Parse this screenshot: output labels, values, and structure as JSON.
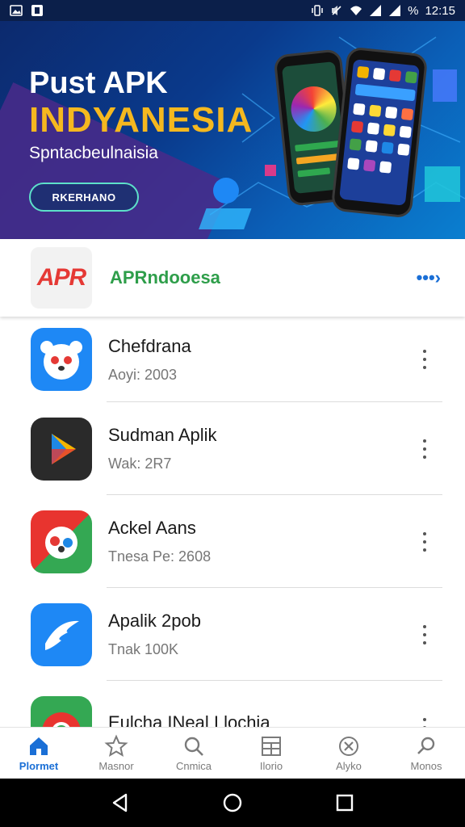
{
  "status_bar": {
    "time": "12:15",
    "battery": "%"
  },
  "banner": {
    "title_line1": "Pust APK",
    "title_line2": "INDYANESIA",
    "subtitle": "Spntacbeulnaisia",
    "cta_label": "RKERHANO"
  },
  "header": {
    "logo_text": "APR",
    "title": "APRndooesa",
    "more_symbol": "•••›"
  },
  "apps": [
    {
      "name": "Chefdrana",
      "meta": "Aoyi: 2003",
      "icon": "panda-icon",
      "color": "#1e88f5"
    },
    {
      "name": "Sudman Aplik",
      "meta": "Wak: 2R7",
      "icon": "play-store-icon",
      "color": "#2a2a2a"
    },
    {
      "name": "Ackel Aans",
      "meta": "Tnesa Pe: 2608",
      "icon": "dog-face-icon",
      "color": "#e8342f"
    },
    {
      "name": "Apalik 2pob",
      "meta": "Tnak 100K",
      "icon": "swoosh-icon",
      "color": "#1e88f5"
    },
    {
      "name": "Eulcha INeal I lochia",
      "meta": "",
      "icon": "chrome-like-icon",
      "color": "#34a853"
    }
  ],
  "bottom_nav": [
    {
      "label": "Plormet",
      "icon": "home-icon",
      "active": true
    },
    {
      "label": "Masnor",
      "icon": "star-icon",
      "active": false
    },
    {
      "label": "Cnmica",
      "icon": "search-icon",
      "active": false
    },
    {
      "label": "Ilorio",
      "icon": "grid-table-icon",
      "active": false
    },
    {
      "label": "Alyko",
      "icon": "close-circle-icon",
      "active": false
    },
    {
      "label": "Monos",
      "icon": "search-icon",
      "active": false
    }
  ],
  "colors": {
    "accent": "#1a6fd6",
    "banner_gold": "#f5b81f",
    "header_green": "#2e9e4a"
  }
}
